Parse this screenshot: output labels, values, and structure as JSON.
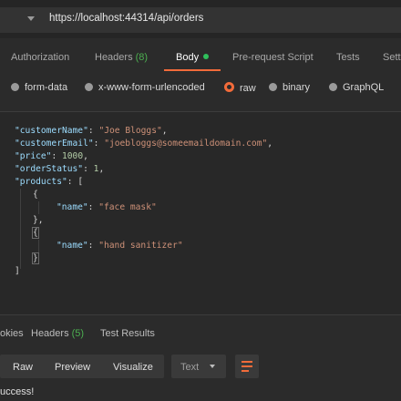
{
  "request": {
    "url": "https://localhost:44314/api/orders"
  },
  "tabs": {
    "authorization": "Authorization",
    "headers": "Headers",
    "headers_count": "(8)",
    "body": "Body",
    "prerequest": "Pre-request Script",
    "tests": "Tests",
    "settings": "Sett"
  },
  "body_types": {
    "form_data": "form-data",
    "urlencoded": "x-www-form-urlencoded",
    "raw": "raw",
    "binary": "binary",
    "graphql": "GraphQL",
    "selected": "raw"
  },
  "editor": {
    "line1_key": "\"customerName\"",
    "line1_val": "\"Joe Bloggs\"",
    "line2_key": "\"customerEmail\"",
    "line2_val": "\"joebloggs@someemaildomain.com\"",
    "line3_key": "\"price\"",
    "line3_val": "1000",
    "line4_key": "\"orderStatus\"",
    "line4_val": "1",
    "line5_key": "\"products\"",
    "item1_key": "\"name\"",
    "item1_val": "\"face mask\"",
    "item2_key": "\"name\"",
    "item2_val": "\"hand sanitizer\""
  },
  "response": {
    "cookies": "okies",
    "headers": "Headers",
    "headers_count": "(5)",
    "test_results": "Test Results",
    "view_raw": "Raw",
    "view_preview": "Preview",
    "view_visualize": "Visualize",
    "format": "Text",
    "result_text": "uccess!"
  },
  "colors": {
    "accent": "#f26b3a",
    "body_dot": "#2fbf5b",
    "count_green": "#4caf50",
    "json_key": "#9cdcfe",
    "json_string": "#ce9178",
    "json_number": "#b5cea8"
  }
}
